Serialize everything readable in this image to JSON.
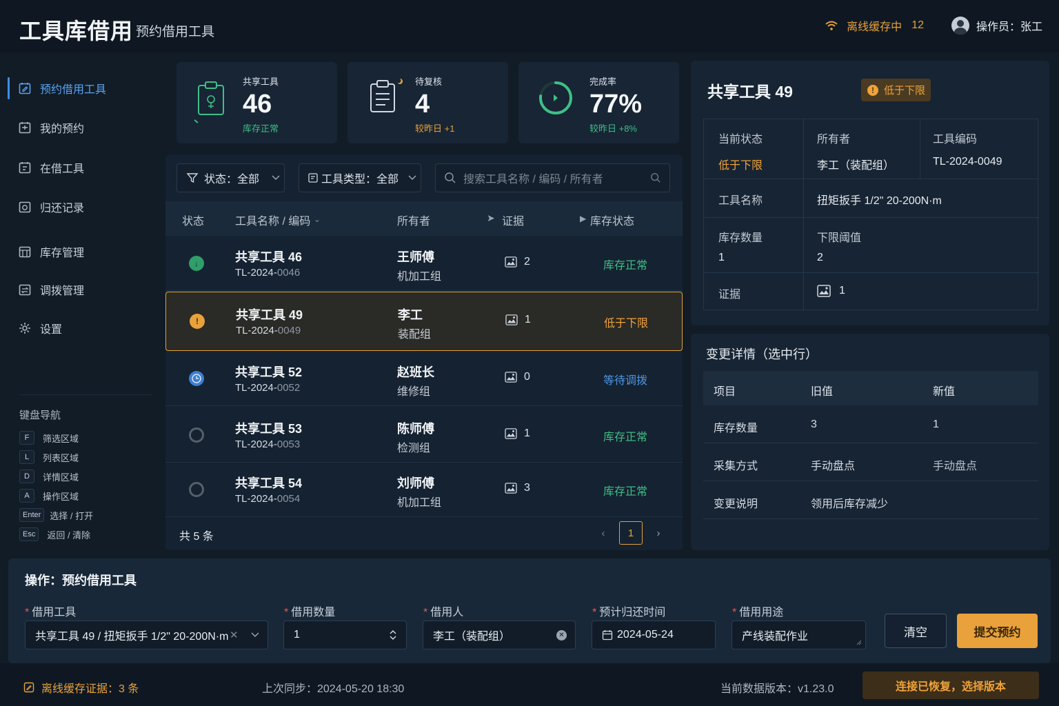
{
  "header": {
    "title": "工具库借用",
    "subtitle": "预约借用工具",
    "offline_label": "离线缓存中",
    "offline_count": "12",
    "operator": "操作员：张工"
  },
  "sidebar": {
    "items": [
      {
        "label": "预约借用工具",
        "icon": "calendar-edit-icon",
        "active": true
      },
      {
        "label": "我的预约",
        "icon": "calendar-icon"
      },
      {
        "label": "在借工具",
        "icon": "tool-box-icon"
      },
      {
        "label": "归还记录",
        "icon": "return-icon"
      },
      {
        "label": "库存管理",
        "icon": "inventory-icon"
      },
      {
        "label": "调拨管理",
        "icon": "transfer-icon"
      },
      {
        "label": "设置",
        "icon": "gear-icon"
      }
    ],
    "keyboard_title": "键盘导航",
    "shortcuts": [
      {
        "key": "F",
        "label": "筛选区域"
      },
      {
        "key": "L",
        "label": "列表区域"
      },
      {
        "key": "D",
        "label": "详情区域"
      },
      {
        "key": "A",
        "label": "操作区域"
      },
      {
        "key": "Enter",
        "label": "选择 / 打开"
      },
      {
        "key": "Esc",
        "label": "返回 / 清除"
      }
    ]
  },
  "stats": [
    {
      "label": "共享工具",
      "value": "46",
      "sub": "库存正常",
      "color": "#3fbf86"
    },
    {
      "label": "待复核",
      "value": "4",
      "sub": "较昨日 +1",
      "color": "#e9a13b"
    },
    {
      "label": "完成率",
      "value": "77%",
      "sub": "较昨日 +8%",
      "color": "#3fbf86",
      "progress": 0.77
    }
  ],
  "filters": {
    "status_label": "状态：",
    "status_value": "全部",
    "type_label": "工具类型：",
    "type_value": "全部",
    "search_placeholder": "搜索工具名称 / 编码 / 所有者"
  },
  "table": {
    "headers": [
      "状态",
      "工具名称 / 编码",
      "所有者",
      "证据",
      "库存状态"
    ],
    "rows": [
      {
        "name": "共享工具 46",
        "code_prefix": "TL-2024-",
        "code_suffix": "0046",
        "owner": "王师傅",
        "group": "机加工组",
        "evidence": "2",
        "status": "库存正常",
        "status_color": "#3fbf86",
        "dot": "green"
      },
      {
        "name": "共享工具 49",
        "code_prefix": "TL-2024-",
        "code_suffix": "0049",
        "owner": "李工",
        "group": "装配组",
        "evidence": "1",
        "status": "低于下限",
        "status_color": "#f0a33a",
        "dot": "amber",
        "selected": true
      },
      {
        "name": "共享工具 52",
        "code_prefix": "TL-2024-",
        "code_suffix": "0052",
        "owner": "赵班长",
        "group": "维修组",
        "evidence": "0",
        "status": "等待调拨",
        "status_color": "#4e95e3",
        "dot": "blue"
      },
      {
        "name": "共享工具 53",
        "code_prefix": "TL-2024-",
        "code_suffix": "0053",
        "owner": "陈师傅",
        "group": "检测组",
        "evidence": "1",
        "status": "库存正常",
        "status_color": "#3fbf86",
        "dot": "gray"
      },
      {
        "name": "共享工具 54",
        "code_prefix": "TL-2024-",
        "code_suffix": "0054",
        "owner": "刘师傅",
        "group": "机加工组",
        "evidence": "3",
        "status": "库存正常",
        "status_color": "#3fbf86",
        "dot": "gray"
      }
    ],
    "total": "共 5 条",
    "page": "1"
  },
  "detail": {
    "title": "共享工具 49",
    "badge": "低于下限",
    "current_status_label": "当前状态",
    "current_status": "低于下限",
    "owner_label": "所有者",
    "owner": "李工（装配组）",
    "code_label": "工具编码",
    "code": "TL-2024-0049",
    "name_label": "工具名称",
    "name": "扭矩扳手 1/2\" 20-200N·m",
    "qty_label": "库存数量",
    "qty": "1",
    "threshold_label": "下限阈值",
    "threshold": "2",
    "evidence_label": "证据",
    "evidence": "1"
  },
  "changes": {
    "title": "变更详情（选中行）",
    "headers": [
      "项目",
      "旧值",
      "新值"
    ],
    "rows": [
      {
        "item": "库存数量",
        "old": "3",
        "new": "1"
      },
      {
        "item": "采集方式",
        "old": "手动盘点",
        "new": "手动盘点"
      },
      {
        "item": "变更说明",
        "old": "领用后库存减少",
        "new": ""
      }
    ]
  },
  "operation": {
    "title": "操作：预约借用工具",
    "tool_label": "借用工具",
    "tool_value": "共享工具 49 / 扭矩扳手 1/2\" 20-200N·m",
    "qty_label": "借用数量",
    "qty_value": "1",
    "borrower_label": "借用人",
    "borrower_value": "李工（装配组）",
    "return_label": "预计归还时间",
    "return_value": "2024-05-24",
    "purpose_label": "借用用途",
    "purpose_value": "产线装配作业",
    "clear_button": "清空",
    "submit_button": "提交预约"
  },
  "footer": {
    "offline_evidence": "离线缓存证据：3 条",
    "last_sync": "上次同步：2024-05-20 18:30",
    "version": "当前数据版本：v1.23.0",
    "reconnect_button": "连接已恢复，选择版本"
  },
  "colors": {
    "accent": "#e9a13b",
    "ok": "#3fbf86",
    "info": "#4e95e3",
    "active_nav": "#5aa4f0"
  }
}
